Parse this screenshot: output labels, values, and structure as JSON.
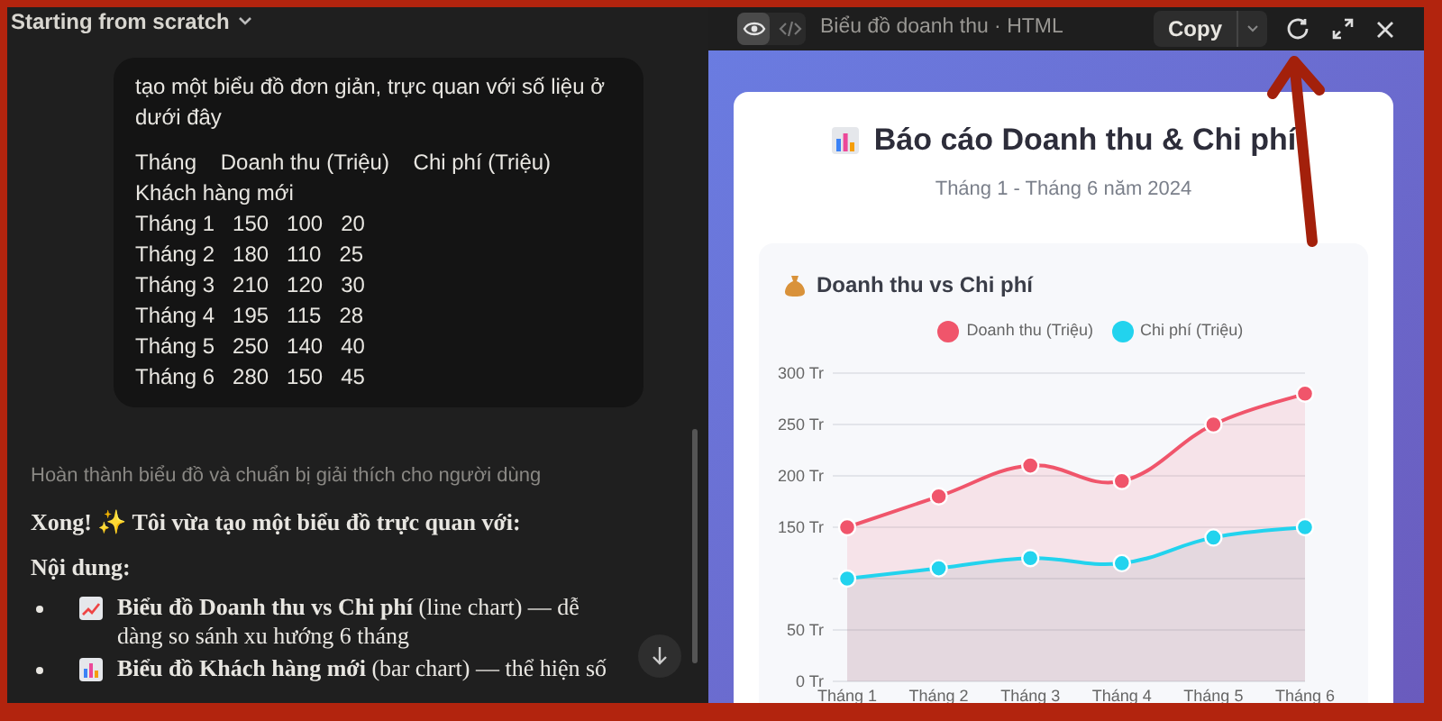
{
  "conversation": {
    "title": "Starting from scratch",
    "user_message": {
      "paragraphs": [
        "tạo một biểu đồ đơn giản, trực quan với số liệu ở dưới đây"
      ],
      "lines": [
        "Tháng    Doanh thu (Triệu)    Chi phí (Triệu)",
        "Khách hàng mới",
        "Tháng 1   150   100   20",
        "Tháng 2   180   110   25",
        "Tháng 3   210   120   30",
        "Tháng 4   195   115   28",
        "Tháng 5   250   140   40",
        "Tháng 6   280   150   45"
      ]
    },
    "thinking": "Hoàn thành biểu đồ và chuẩn bị giải thích cho người dùng",
    "reply": {
      "intro": "Xong! ✨ Tôi vừa tạo một biểu đồ trực quan với:",
      "heading": "Nội dung:",
      "bullets": [
        {
          "kind": "line",
          "text": "**Biểu đồ Doanh thu vs Chi phí** (line chart) — dễ dàng so sánh xu hướng 6 tháng"
        },
        {
          "kind": "bar",
          "text": "**Biểu đồ Khách hàng mới** (bar chart) — thể hiện số"
        }
      ]
    }
  },
  "artifact": {
    "view_toggle": [
      {
        "kind": "preview",
        "selected": true
      },
      {
        "kind": "code",
        "selected": false
      }
    ],
    "title": "Biểu đồ doanh thu · HTML",
    "copy_label": "Copy",
    "report": {
      "title": "Báo cáo Doanh thu & Chi phí",
      "subtitle": "Tháng 1 - Tháng 6 năm 2024",
      "chart_title": "Doanh thu vs Chi phí",
      "chart_data": {
        "type": "area",
        "categories": [
          "Tháng 1",
          "Tháng 2",
          "Tháng 3",
          "Tháng 4",
          "Tháng 5",
          "Tháng 6"
        ],
        "series": [
          {
            "name": "Doanh thu (Triệu)",
            "color": "#f0556b",
            "values": [
              150,
              180,
              210,
              195,
              250,
              280
            ]
          },
          {
            "name": "Chi phí (Triệu)",
            "color": "#22d3ee",
            "values": [
              100,
              110,
              120,
              115,
              140,
              150
            ]
          }
        ],
        "ylim": [
          0,
          300
        ],
        "grid": true,
        "legend": true,
        "yticks": [
          {
            "value": 0,
            "label": "0 Tr"
          },
          {
            "value": 50,
            "label": "50 Tr"
          },
          {
            "value": 150,
            "label": "150 Tr"
          },
          {
            "value": 200,
            "label": "200 Tr"
          },
          {
            "value": 250,
            "label": "250 Tr"
          },
          {
            "value": 300,
            "label": "300 Tr"
          }
        ]
      }
    }
  }
}
